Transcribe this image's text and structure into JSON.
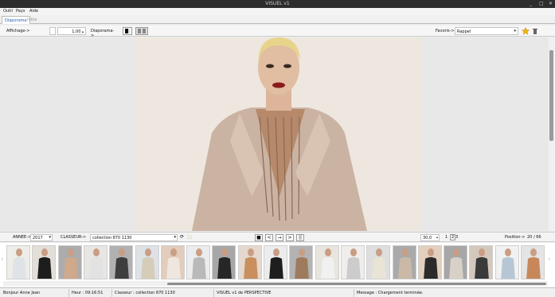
{
  "window": {
    "title": "VISUEL v1",
    "min_label": "_",
    "max_label": "□",
    "close_label": "✕"
  },
  "menu": {
    "items": [
      "Outil",
      "Pays",
      "Aide"
    ]
  },
  "tabs": [
    {
      "label": "Diaporama",
      "active": true
    },
    {
      "label": "Inbla",
      "active": false
    }
  ],
  "toolbar": {
    "affichage_label": "Affichage->",
    "zoom_value": "1,00",
    "diaporama_label": "Diaporama->",
    "favoris_label": "Favoris->",
    "favoris_value": "Rappel"
  },
  "controls": {
    "annee_label": "ANNEE->",
    "annee_value": "2017",
    "classeur_label": "CLASSEUR->",
    "classeur_value": "collection 870 1130",
    "play_buttons": [
      "■",
      "<",
      "→",
      ">",
      "||"
    ],
    "speed_value": "30,0",
    "page_numbers": [
      "1",
      "2",
      "3"
    ],
    "position_label": "Position->",
    "position_value": "20 / 66"
  },
  "thumbnails": {
    "count": 21,
    "palette": [
      "#e9e4d6",
      "#c9b9a6",
      "#2b2b2b",
      "#d8d1c8",
      "#3a3a3a",
      "#b7c6d4",
      "#c7875a",
      "#dfe3e8",
      "#1d1d1d",
      "#cfa98b",
      "#e2e2e2",
      "#3e3e3e",
      "#d6cdb9",
      "#efe6df",
      "#b9b9b9",
      "#262626",
      "#c98f5e",
      "#1e1e1e",
      "#9f7b5d",
      "#f1f1f1",
      "#cccccc"
    ]
  },
  "status": {
    "greeting": "Bonjour Anne Jean",
    "hour": "Heur : 09:16:51",
    "classeur": "Classeur : collection 870 1130",
    "version": "VISUEL v1 de PERSPECTIVE",
    "message": "Message : Chargement terminée."
  }
}
